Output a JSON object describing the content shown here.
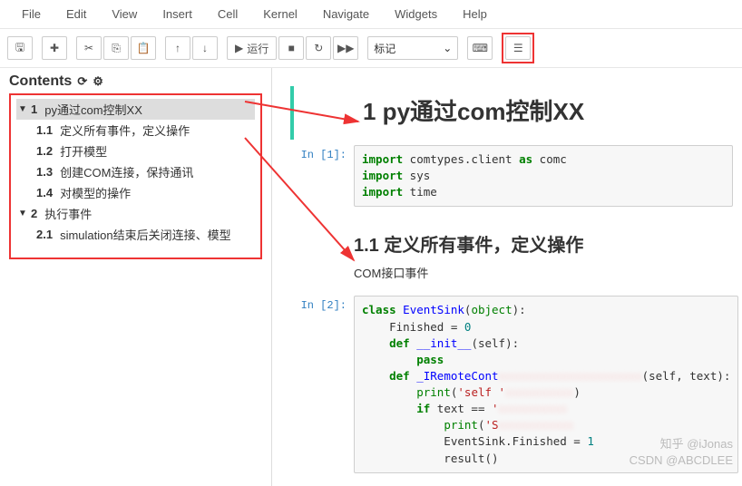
{
  "menu": {
    "file": "File",
    "edit": "Edit",
    "view": "View",
    "insert": "Insert",
    "cell": "Cell",
    "kernel": "Kernel",
    "navigate": "Navigate",
    "widgets": "Widgets",
    "help": "Help"
  },
  "toolbar": {
    "run_label": "运行",
    "cell_type": "标记"
  },
  "toc": {
    "title": "Contents",
    "items": [
      {
        "num": "1",
        "label": "py通过com控制XX",
        "level": 1,
        "selected": true,
        "expand": true
      },
      {
        "num": "1.1",
        "label": "定义所有事件，定义操作",
        "level": 2
      },
      {
        "num": "1.2",
        "label": "打开模型",
        "level": 2
      },
      {
        "num": "1.3",
        "label": "创建COM连接，保持通讯",
        "level": 2
      },
      {
        "num": "1.4",
        "label": "对模型的操作",
        "level": 2
      },
      {
        "num": "2",
        "label": "执行事件",
        "level": 1,
        "expand": true
      },
      {
        "num": "2.1",
        "label": "simulation结束后关闭连接、模型",
        "level": 2
      }
    ]
  },
  "notebook": {
    "h1": "1  py通过com控制XX",
    "prompt1": "In [1]:",
    "h2": "1.1  定义所有事件，定义操作",
    "text1": "COM接口事件",
    "prompt2": "In [2]:"
  },
  "watermark": {
    "line1": "知乎 @iJonas",
    "line2": "CSDN @ABCDLEE"
  }
}
